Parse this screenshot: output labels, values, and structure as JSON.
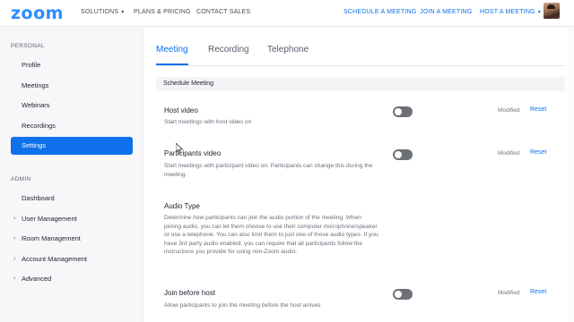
{
  "brand": {
    "logo": "zoom",
    "accent": "#0E71EB",
    "logo_color": "#2D8CFF"
  },
  "topnav": {
    "solutions": "SOLUTIONS",
    "plans": "PLANS & PRICING",
    "contact": "CONTACT SALES",
    "schedule": "SCHEDULE A MEETING",
    "join": "JOIN A MEETING",
    "host": "HOST A MEETING"
  },
  "sidebar": {
    "personal_heading": "PERSONAL",
    "personal_items": [
      "Profile",
      "Meetings",
      "Webinars",
      "Recordings",
      "Settings"
    ],
    "active_item": "Settings",
    "admin_heading": "ADMIN",
    "admin_items": [
      "Dashboard",
      "User Management",
      "Room Management",
      "Account Management",
      "Advanced"
    ]
  },
  "tabs": [
    "Meeting",
    "Recording",
    "Telephone"
  ],
  "active_tab": "Meeting",
  "section": {
    "title": "Schedule Meeting"
  },
  "settings": [
    {
      "title": "Host video",
      "description": "Start meetings with host video on",
      "toggle_on": false,
      "modified": "Modified",
      "reset": "Reset"
    },
    {
      "title": "Participants video",
      "description": "Start meetings with participant video on. Participants can change this during the meeting.",
      "toggle_on": false,
      "modified": "Modified",
      "reset": "Reset"
    },
    {
      "title": "Audio Type",
      "description": "Determine how participants can join the audio portion of the meeting. When joining audio, you can let them choose to use their computer microphone/speaker or use a telephone. You can also limit them to just one of those audio types. If you have 3rd party audio enabled, you can require that all participants follow the instructions you provide for using non-Zoom audio."
    },
    {
      "title": "Join before host",
      "description": "Allow participants to join the meeting before the host arrives",
      "toggle_on": false,
      "modified": "Modified",
      "reset": "Reset"
    }
  ]
}
